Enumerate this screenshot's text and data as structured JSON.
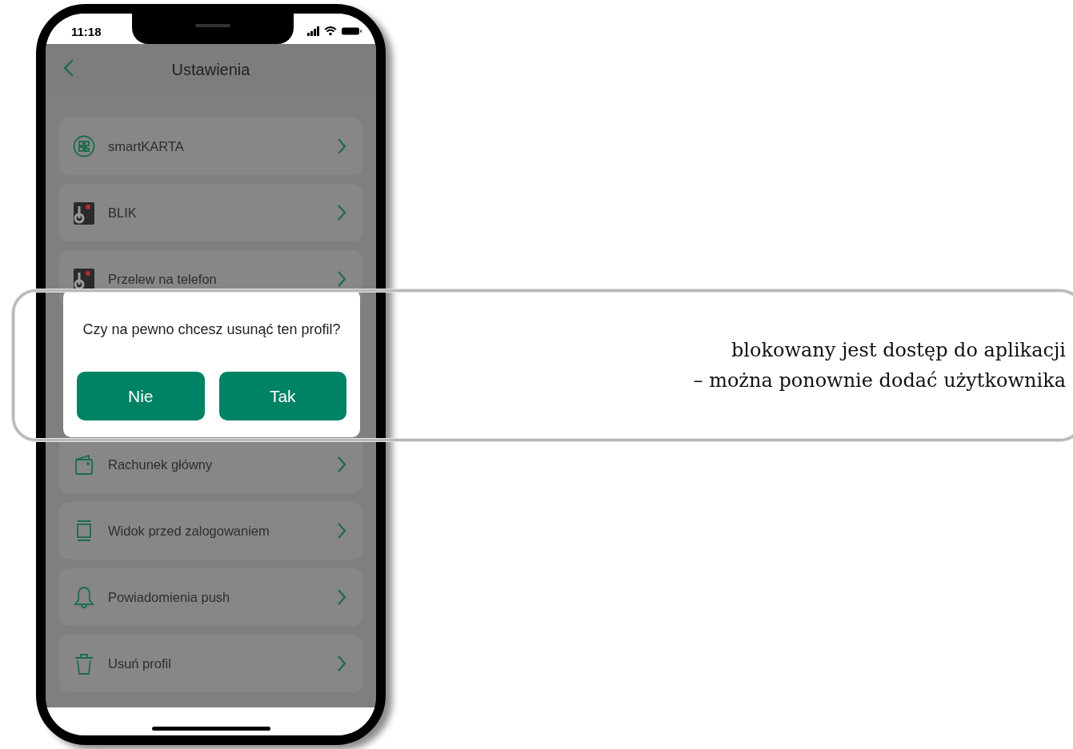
{
  "status_bar": {
    "time": "11:18"
  },
  "header": {
    "title": "Ustawienia"
  },
  "payment_items": [
    {
      "label": "smartKARTA",
      "kind": "qr"
    },
    {
      "label": "BLIK",
      "kind": "blik"
    },
    {
      "label": "Przelew na telefon",
      "kind": "blik"
    }
  ],
  "other_items": [
    {
      "label": "Rachunek główny",
      "kind": "wallet"
    },
    {
      "label": "Widok przed zalogowaniem",
      "kind": "screen"
    },
    {
      "label": "Powiadomienia push",
      "kind": "bell"
    },
    {
      "label": "Usuń profil",
      "kind": "trash"
    }
  ],
  "dialog": {
    "message": "Czy na pewno chcesz usunąć ten profil?",
    "buttons": [
      "Nie",
      "Tak"
    ]
  },
  "callout": {
    "lines": [
      "blokowany jest dostęp do aplikacji",
      "– można ponownie dodać użytkownika"
    ]
  }
}
